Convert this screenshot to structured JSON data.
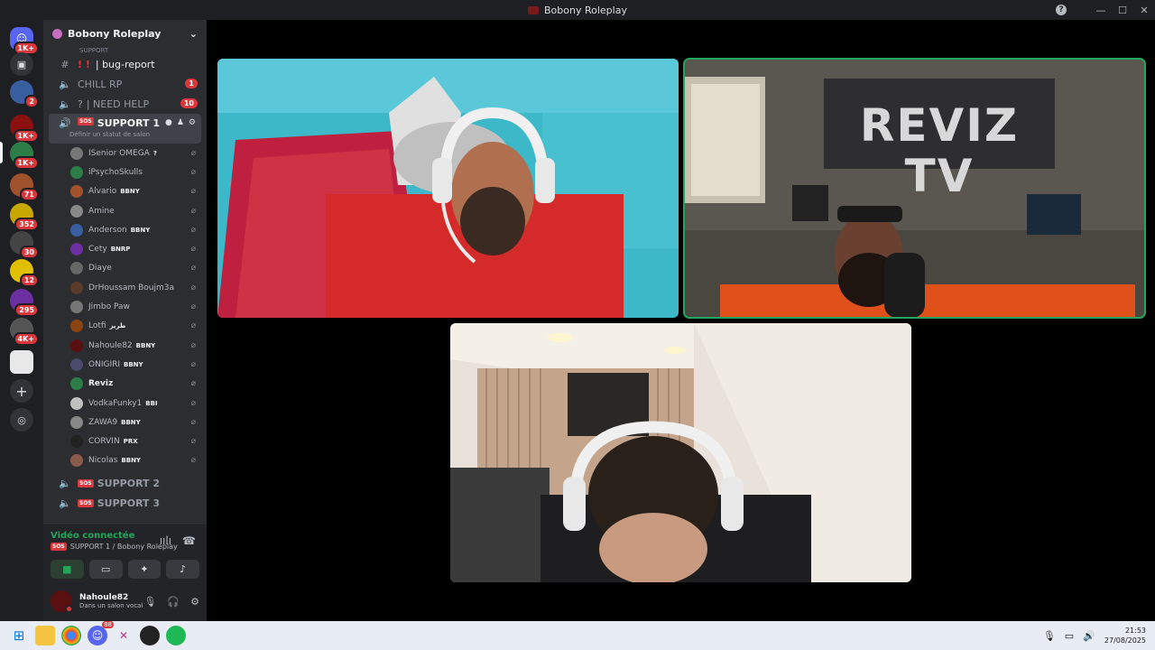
{
  "window": {
    "title": "Bobony Roleplay"
  },
  "rail": {
    "servers": [
      {
        "badge": "1K+",
        "color": "#5865f2"
      },
      {
        "badge": "",
        "color": "#313338"
      },
      {
        "badge": "2",
        "color": "#3a5fa0"
      },
      {
        "badge": "1K+",
        "color": "#8b1010"
      },
      {
        "badge": "1K+",
        "color": "#2d7d46"
      },
      {
        "badge": "71",
        "color": "#a0522d"
      },
      {
        "badge": "352",
        "color": "#c8a800"
      },
      {
        "badge": "30",
        "color": "#444"
      },
      {
        "badge": "12",
        "color": "#e0c000"
      },
      {
        "badge": "295",
        "color": "#6b2fa0"
      },
      {
        "badge": "4K+",
        "color": "#555"
      }
    ]
  },
  "server_name": "Bobony Roleplay",
  "category_peek": "SUPPORT",
  "channels": {
    "bug_report": "| bug-report",
    "bug_marks": "! !",
    "chill": "CHILL RP",
    "chill_count": "1",
    "need_help": "| NEED HELP",
    "need_help_q": "?",
    "need_help_count": "10",
    "support1": "SUPPORT 1",
    "support1_sub": "Définir un statut de salon",
    "support2": "SUPPORT 2",
    "support3": "SUPPORT 3",
    "sos": "SOS"
  },
  "members": [
    {
      "name": "ISenior OMEGA",
      "tag": "?",
      "color": "#777"
    },
    {
      "name": "iPsychoSkulls",
      "tag": "",
      "color": "#2d7d46"
    },
    {
      "name": "Alvario",
      "tag": "BBNY",
      "color": "#a0522d"
    },
    {
      "name": "Amine",
      "tag": "",
      "color": "#888"
    },
    {
      "name": "Anderson",
      "tag": "BBNY",
      "color": "#3a5fa0"
    },
    {
      "name": "Cety",
      "tag": "BNRP",
      "color": "#6b2fa0"
    },
    {
      "name": "Diaye",
      "tag": "",
      "color": "#666"
    },
    {
      "name": "DrHoussam Boujm3a",
      "tag": "",
      "color": "#5a3a2a"
    },
    {
      "name": "Jimbo Paw",
      "tag": "",
      "color": "#777"
    },
    {
      "name": "Lotfi",
      "tag": "طريز",
      "color": "#8b4513"
    },
    {
      "name": "Nahoule82",
      "tag": "BBNY",
      "color": "#5a1010"
    },
    {
      "name": "ONIGIRI",
      "tag": "BBNY",
      "color": "#4a4a6a"
    },
    {
      "name": "Reviz",
      "tag": "",
      "color": "#2d7d46"
    },
    {
      "name": "VodkaFunky1",
      "tag": "BBI",
      "color": "#c0c0c0"
    },
    {
      "name": "ZAWA9",
      "tag": "BBNY",
      "color": "#888"
    },
    {
      "name": "CORVIN",
      "tag": "PRX",
      "color": "#222"
    },
    {
      "name": "Nicolas",
      "tag": "BBNY",
      "color": "#8a5a4a"
    }
  ],
  "voice": {
    "status": "Vidéo connectée",
    "channel": "SUPPORT 1 / Bobony Roleplay"
  },
  "user": {
    "name": "Nahoule82",
    "sub": "Dans un salon vocal"
  },
  "videos": {
    "tile2_sign": "REVIZ TV"
  },
  "taskbar": {
    "time": "21:53",
    "date": "27/08/2025",
    "discord_badge": "88"
  }
}
